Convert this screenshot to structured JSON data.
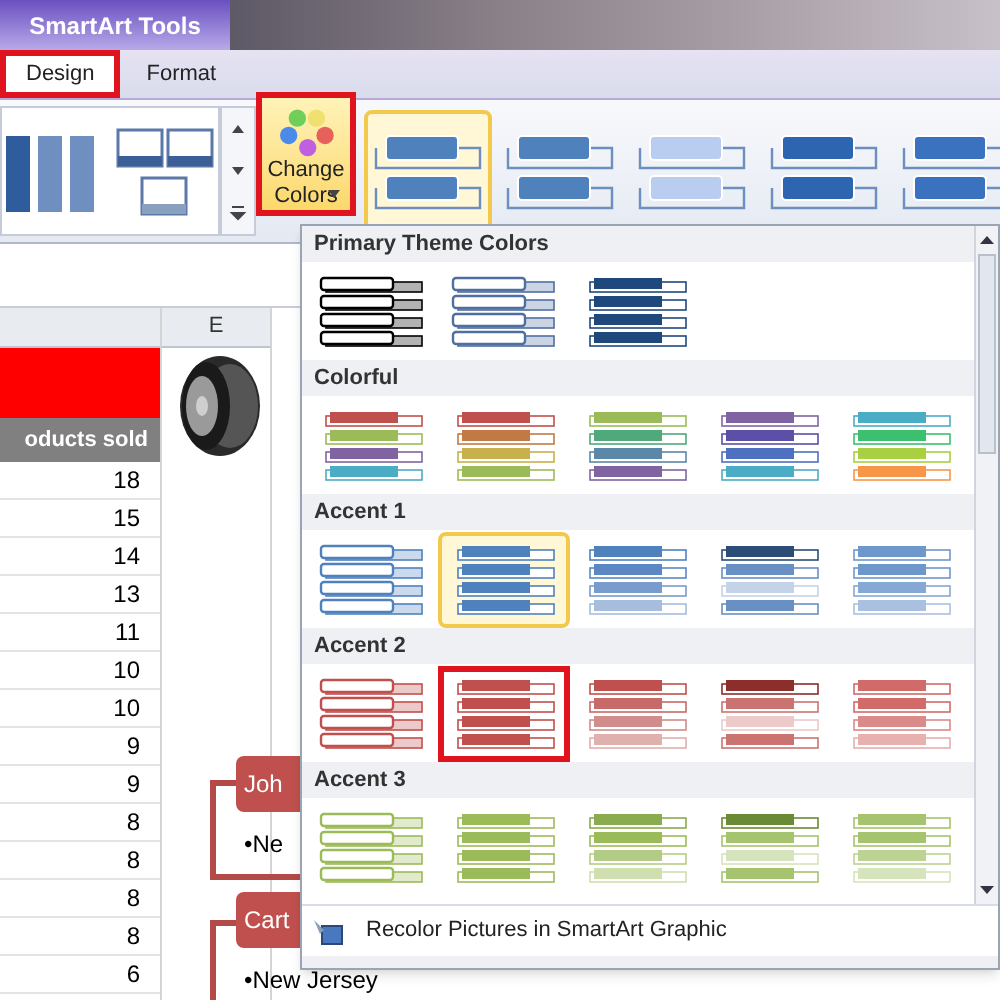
{
  "contextual_tab_group": "SmartArt Tools",
  "tabs": [
    {
      "label": "Design",
      "selected": true,
      "highlighted": true
    },
    {
      "label": "Format",
      "selected": false,
      "highlighted": false
    }
  ],
  "change_colors_button": {
    "label": "Change Colors",
    "highlighted": true
  },
  "style_gallery": [
    {
      "color": "#4f81bd",
      "selected": true
    },
    {
      "color": "#4f81bd",
      "selected": false
    },
    {
      "color": "#b9cdf0",
      "selected": false
    },
    {
      "color": "#2e65b0",
      "selected": false
    },
    {
      "color": "#3a72c0",
      "selected": false
    }
  ],
  "sheet": {
    "column_header": "E",
    "header_cell": "oducts sold",
    "values": [
      "18",
      "15",
      "14",
      "13",
      "11",
      "10",
      "10",
      "9",
      "9",
      "8",
      "8",
      "8",
      "8",
      "6"
    ]
  },
  "smartart": [
    {
      "name": "Joh",
      "item": "•Ne"
    },
    {
      "name": "Cart",
      "item": "•New Jersey"
    }
  ],
  "color_menu": {
    "sections": [
      {
        "title": "Primary Theme Colors",
        "swatches": [
          {
            "kind": "outline",
            "selected": false,
            "highlighted": false,
            "bars": [
              {
                "color": "#000000"
              },
              {
                "color": "#000000"
              },
              {
                "color": "#000000"
              },
              {
                "color": "#000000"
              }
            ]
          },
          {
            "kind": "outline",
            "selected": false,
            "highlighted": false,
            "bars": [
              {
                "color": "#4f6fa0"
              },
              {
                "color": "#4f6fa0"
              },
              {
                "color": "#4f6fa0"
              },
              {
                "color": "#4f6fa0"
              }
            ]
          },
          {
            "kind": "fill",
            "selected": false,
            "highlighted": false,
            "bars": [
              {
                "color": "#1f497d"
              },
              {
                "color": "#1f497d"
              },
              {
                "color": "#1f497d"
              },
              {
                "color": "#1f497d"
              }
            ]
          }
        ]
      },
      {
        "title": "Colorful",
        "swatches": [
          {
            "kind": "fill",
            "selected": false,
            "highlighted": false,
            "bars": [
              {
                "color": "#c0504d"
              },
              {
                "color": "#9bbb59"
              },
              {
                "color": "#8064a2"
              },
              {
                "color": "#4bacc6"
              }
            ]
          },
          {
            "kind": "fill",
            "selected": false,
            "highlighted": false,
            "bars": [
              {
                "color": "#c0504d"
              },
              {
                "color": "#c27a45"
              },
              {
                "color": "#c8b04d"
              },
              {
                "color": "#9bbb59"
              }
            ]
          },
          {
            "kind": "fill",
            "selected": false,
            "highlighted": false,
            "bars": [
              {
                "color": "#9bbb59"
              },
              {
                "color": "#4fa97a"
              },
              {
                "color": "#5b87a8"
              },
              {
                "color": "#8064a2"
              }
            ]
          },
          {
            "kind": "fill",
            "selected": false,
            "highlighted": false,
            "bars": [
              {
                "color": "#8064a2"
              },
              {
                "color": "#5b4fa8"
              },
              {
                "color": "#4f6fc0"
              },
              {
                "color": "#4bacc6"
              }
            ]
          },
          {
            "kind": "fill",
            "selected": false,
            "highlighted": false,
            "bars": [
              {
                "color": "#4bacc6"
              },
              {
                "color": "#3cc070"
              },
              {
                "color": "#a8d040"
              },
              {
                "color": "#f79646"
              }
            ]
          }
        ]
      },
      {
        "title": "Accent 1",
        "swatches": [
          {
            "kind": "outline",
            "selected": false,
            "highlighted": false,
            "bars": [
              {
                "color": "#4f81bd"
              },
              {
                "color": "#4f81bd"
              },
              {
                "color": "#4f81bd"
              },
              {
                "color": "#4f81bd"
              }
            ]
          },
          {
            "kind": "fill",
            "selected": true,
            "highlighted": false,
            "bars": [
              {
                "color": "#4f81bd"
              },
              {
                "color": "#4f81bd"
              },
              {
                "color": "#4f81bd"
              },
              {
                "color": "#4f81bd"
              }
            ]
          },
          {
            "kind": "fill",
            "selected": false,
            "highlighted": false,
            "bars": [
              {
                "color": "#4f81bd"
              },
              {
                "color": "#5b88c2"
              },
              {
                "color": "#7a9ccc"
              },
              {
                "color": "#a6bddd"
              }
            ]
          },
          {
            "kind": "fill",
            "selected": false,
            "highlighted": false,
            "bars": [
              {
                "color": "#2c4d75"
              },
              {
                "color": "#6890c4"
              },
              {
                "color": "#c5d3e8"
              },
              {
                "color": "#6890c4"
              }
            ]
          },
          {
            "kind": "fill",
            "selected": false,
            "highlighted": false,
            "bars": [
              {
                "color": "#6e97cc"
              },
              {
                "color": "#6e97cc"
              },
              {
                "color": "#86a8d4"
              },
              {
                "color": "#a9c0e0"
              }
            ]
          }
        ]
      },
      {
        "title": "Accent 2",
        "swatches": [
          {
            "kind": "outline",
            "selected": false,
            "highlighted": false,
            "bars": [
              {
                "color": "#c0504d"
              },
              {
                "color": "#c0504d"
              },
              {
                "color": "#c0504d"
              },
              {
                "color": "#c0504d"
              }
            ]
          },
          {
            "kind": "fill",
            "selected": false,
            "highlighted": true,
            "bars": [
              {
                "color": "#c0504d"
              },
              {
                "color": "#c0504d"
              },
              {
                "color": "#c0504d"
              },
              {
                "color": "#c0504d"
              }
            ]
          },
          {
            "kind": "fill",
            "selected": false,
            "highlighted": false,
            "bars": [
              {
                "color": "#c0504d"
              },
              {
                "color": "#c86a67"
              },
              {
                "color": "#d08d8b"
              },
              {
                "color": "#dfb0ae"
              }
            ]
          },
          {
            "kind": "fill",
            "selected": false,
            "highlighted": false,
            "bars": [
              {
                "color": "#8b2e2c"
              },
              {
                "color": "#cb7371"
              },
              {
                "color": "#eccaca"
              },
              {
                "color": "#cb7371"
              }
            ]
          },
          {
            "kind": "fill",
            "selected": false,
            "highlighted": false,
            "bars": [
              {
                "color": "#d06b69"
              },
              {
                "color": "#d06b69"
              },
              {
                "color": "#da8a88"
              },
              {
                "color": "#e8b0af"
              }
            ]
          }
        ]
      },
      {
        "title": "Accent 3",
        "swatches": [
          {
            "kind": "outline",
            "selected": false,
            "highlighted": false,
            "bars": [
              {
                "color": "#9bbb59"
              },
              {
                "color": "#9bbb59"
              },
              {
                "color": "#9bbb59"
              },
              {
                "color": "#9bbb59"
              }
            ]
          },
          {
            "kind": "fill",
            "selected": false,
            "highlighted": false,
            "bars": [
              {
                "color": "#9bbb59"
              },
              {
                "color": "#9bbb59"
              },
              {
                "color": "#9bbb59"
              },
              {
                "color": "#9bbb59"
              }
            ]
          },
          {
            "kind": "fill",
            "selected": false,
            "highlighted": false,
            "bars": [
              {
                "color": "#8aac4e"
              },
              {
                "color": "#9bbb59"
              },
              {
                "color": "#b3cc85"
              },
              {
                "color": "#cfdfb0"
              }
            ]
          },
          {
            "kind": "fill",
            "selected": false,
            "highlighted": false,
            "bars": [
              {
                "color": "#6a8a35"
              },
              {
                "color": "#a6c46f"
              },
              {
                "color": "#d6e4bd"
              },
              {
                "color": "#a6c46f"
              }
            ]
          },
          {
            "kind": "fill",
            "selected": false,
            "highlighted": false,
            "bars": [
              {
                "color": "#a6c46f"
              },
              {
                "color": "#a6c46f"
              },
              {
                "color": "#bcd394"
              },
              {
                "color": "#d6e4bd"
              }
            ]
          }
        ]
      }
    ],
    "footer": "Recolor Pictures in SmartArt Graphic"
  }
}
